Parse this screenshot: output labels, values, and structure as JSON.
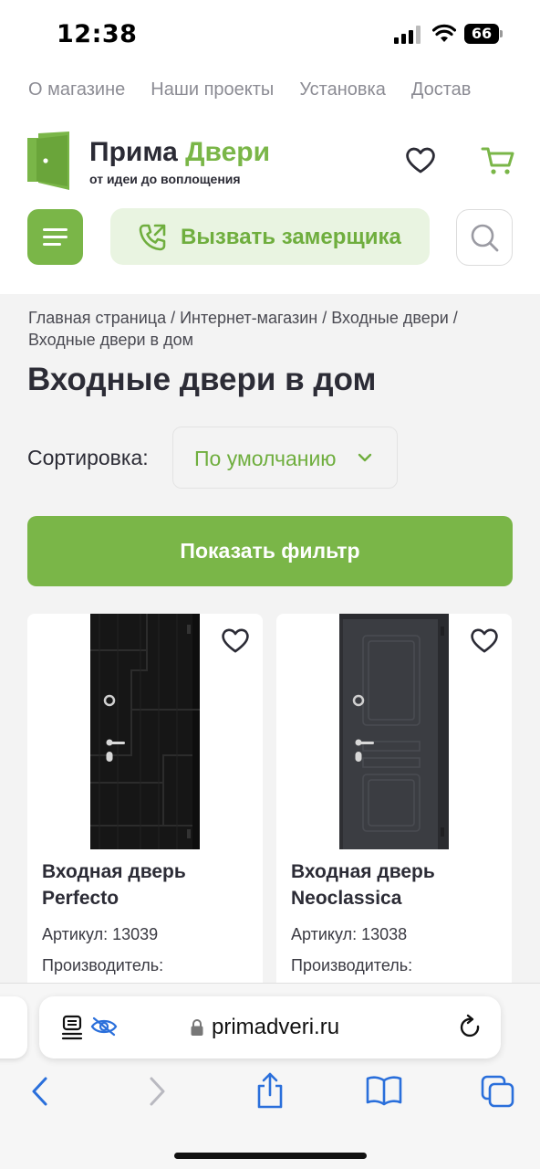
{
  "status_bar": {
    "time": "12:38",
    "battery": "66"
  },
  "top_nav": [
    "О магазине",
    "Наши проекты",
    "Установка",
    "Достав"
  ],
  "logo": {
    "name_part1": "Прима",
    "name_part2": "Двери",
    "tagline": "от идеи до воплощения"
  },
  "header": {
    "call_label": "Вызвать замерщика"
  },
  "breadcrumb": "Главная страница / Интернет-магазин / Входные двери / Входные двери в дом",
  "page_title": "Входные двери в дом",
  "sort": {
    "label": "Сортировка:",
    "value": "По умолчанию"
  },
  "filter_label": "Показать фильтр",
  "products": [
    {
      "name": "Входная дверь Perfecto",
      "sku": "Артикул: 13039",
      "manufacturer": "Производитель:"
    },
    {
      "name": "Входная дверь Neoclassica",
      "sku": "Артикул: 13038",
      "manufacturer": "Производитель:"
    }
  ],
  "browser": {
    "url": "primadveri.ru"
  },
  "colors": {
    "accent": "#7ab648",
    "accent_light": "#e9f4e1",
    "text": "#2c2c36"
  },
  "icons": [
    "heart-icon",
    "cart-icon",
    "menu-icon",
    "phone-icon",
    "search-icon",
    "chevron-down-icon",
    "lock-icon",
    "reload-icon",
    "back-icon",
    "forward-icon",
    "share-icon",
    "bookmarks-icon",
    "tabs-icon"
  ]
}
